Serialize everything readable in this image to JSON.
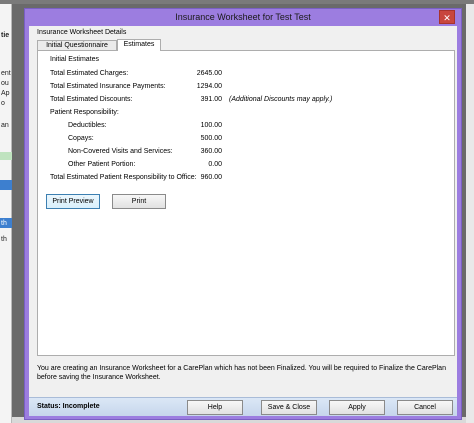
{
  "window": {
    "title": "Insurance Worksheet for Test Test",
    "close_glyph": "✕",
    "group_title": "Insurance Worksheet Details"
  },
  "tabs": [
    {
      "label": "Initial Questionnaire",
      "active": false
    },
    {
      "label": "Estimates",
      "active": true
    }
  ],
  "estimates": {
    "section_label": "Initial Estimates",
    "rows": [
      {
        "label": "Total Estimated Charges:",
        "value": "2645.00",
        "note": ""
      },
      {
        "label": "Total Estimated Insurance Payments:",
        "value": "1294.00",
        "note": ""
      },
      {
        "label": "Total Estimated Discounts:",
        "value": "391.00",
        "note": "(Additional Discounts may apply.)"
      },
      {
        "label": "Patient Responsibility:",
        "value": "",
        "note": ""
      },
      {
        "label": "Deductibles:",
        "value": "100.00",
        "note": ""
      },
      {
        "label": "Copays:",
        "value": "500.00",
        "note": ""
      },
      {
        "label": "Non-Covered Visits and Services:",
        "value": "360.00",
        "note": ""
      },
      {
        "label": "Other Patient Portion:",
        "value": "0.00",
        "note": ""
      },
      {
        "label": "Total Estimated Patient Responsibility to Office:",
        "value": "960.00",
        "note": ""
      }
    ]
  },
  "print_buttons": {
    "print_preview": "Print Preview",
    "print": "Print"
  },
  "notice": "You are creating an Insurance Worksheet for a CarePlan which has not been Finalized.  You will be required to Finalize the CarePlan before saving the Insurance Worksheet.",
  "statusbar": {
    "status": "Status:  Incomplete",
    "help": "Help",
    "save_close": "Save & Close",
    "apply": "Apply",
    "cancel": "Cancel"
  },
  "background": {
    "fragments": [
      "tie",
      "ent",
      "ou",
      "Ap",
      "o",
      "an",
      "th",
      "th"
    ]
  },
  "colors": {
    "window_frame": "#9c7de0",
    "close_button": "#c8463d",
    "statusbar": "#c6d6ec"
  }
}
